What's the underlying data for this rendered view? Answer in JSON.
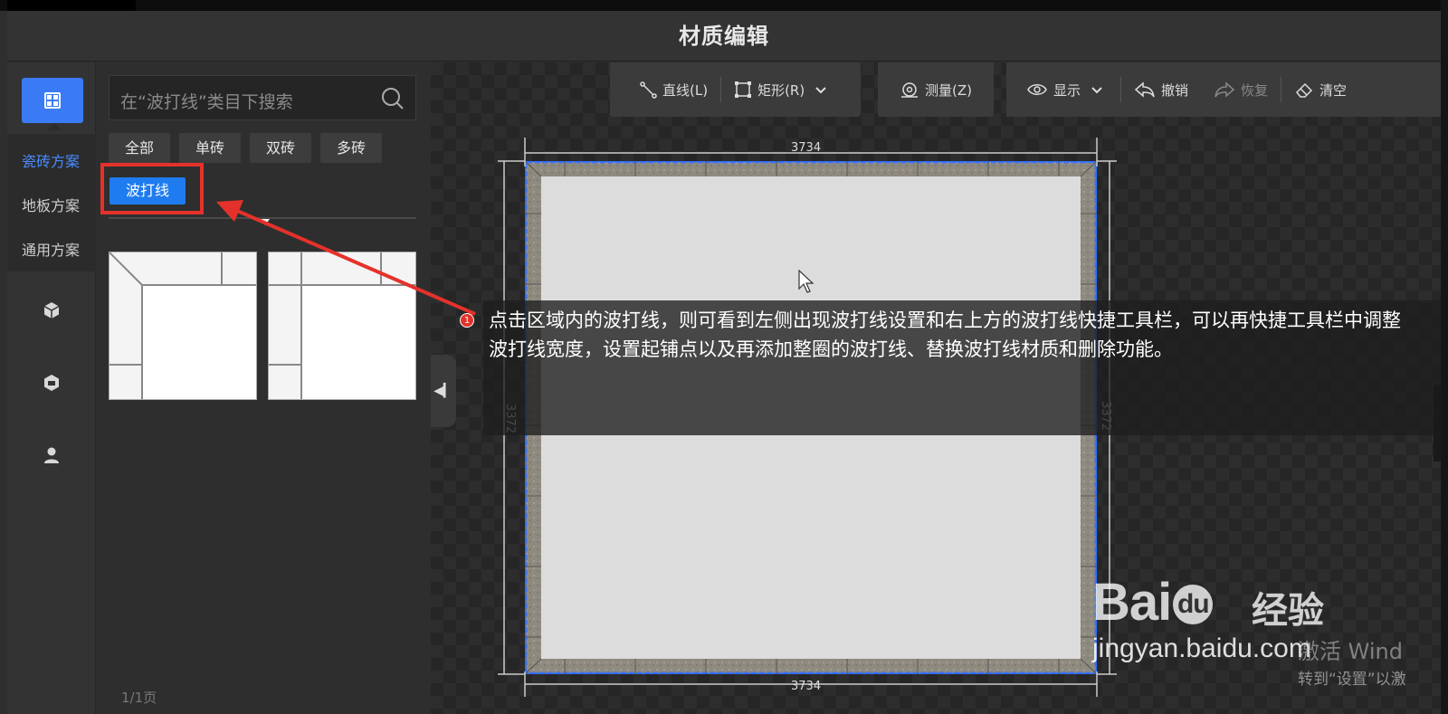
{
  "title": "材质编辑",
  "leftnav": {
    "items": [
      "瓷砖方案",
      "地板方案",
      "通用方案"
    ],
    "active_index": 0,
    "icons": [
      "grid-icon",
      "cube-icon",
      "box-icon",
      "user-icon"
    ]
  },
  "panel": {
    "search_placeholder": "在“波打线”类目下搜索",
    "chips": [
      "全部",
      "单砖",
      "双砖",
      "多砖",
      "波打线"
    ],
    "active_chip": "波打线",
    "pager": "1/1页"
  },
  "toolbar": {
    "line": "直线(L)",
    "rect": "矩形(R)",
    "measure": "测量(Z)",
    "display": "显示",
    "undo": "撤销",
    "redo": "恢复",
    "clear": "清空"
  },
  "room": {
    "width_top": "3734",
    "width_bottom": "3734",
    "height_left": "3372",
    "height_right": "3372"
  },
  "tooltip": {
    "badge": "1",
    "text": "点击区域内的波打线，则可看到左侧出现波打线设置和右上方的波打线快捷工具栏，可以再快捷工具栏中调整波打线宽度，设置起铺点以及再添加整圈的波打线、替换波打线材质和删除功能。"
  },
  "watermark": {
    "brand": "Bai",
    "brand2": "du",
    "brand_cn": "经验",
    "url": "jingyan.baidu.com"
  },
  "os_notice": {
    "line1": "激活 Wind",
    "line2": "转到“设置”以激"
  },
  "colors": {
    "accent": "#1f7cf0",
    "highlight": "#e4322b"
  }
}
